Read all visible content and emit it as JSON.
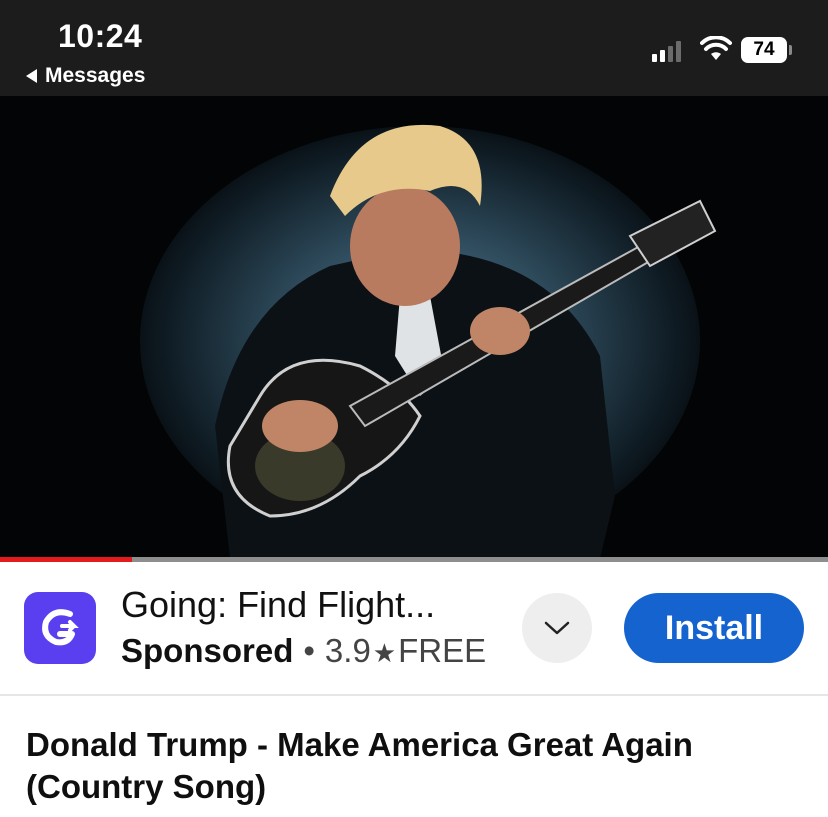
{
  "status_bar": {
    "time": "10:24",
    "back_label": "Messages",
    "battery": "74",
    "signal_bars_active": 2,
    "signal_bars_total": 4
  },
  "video": {
    "image_icon": "video-thumbnail-image",
    "progress": 0.16,
    "progress_color": "#e31b1b"
  },
  "ad": {
    "app_name": "Going: Find Flight...",
    "sponsored": "Sponsored",
    "separator": "•",
    "rating": "3.9",
    "star": "★",
    "price": "FREE",
    "install_label": "Install",
    "accent": "#1463cf",
    "icon": "going-app-icon"
  },
  "video_title": "Donald Trump - Make America Great Again (Country Song)"
}
